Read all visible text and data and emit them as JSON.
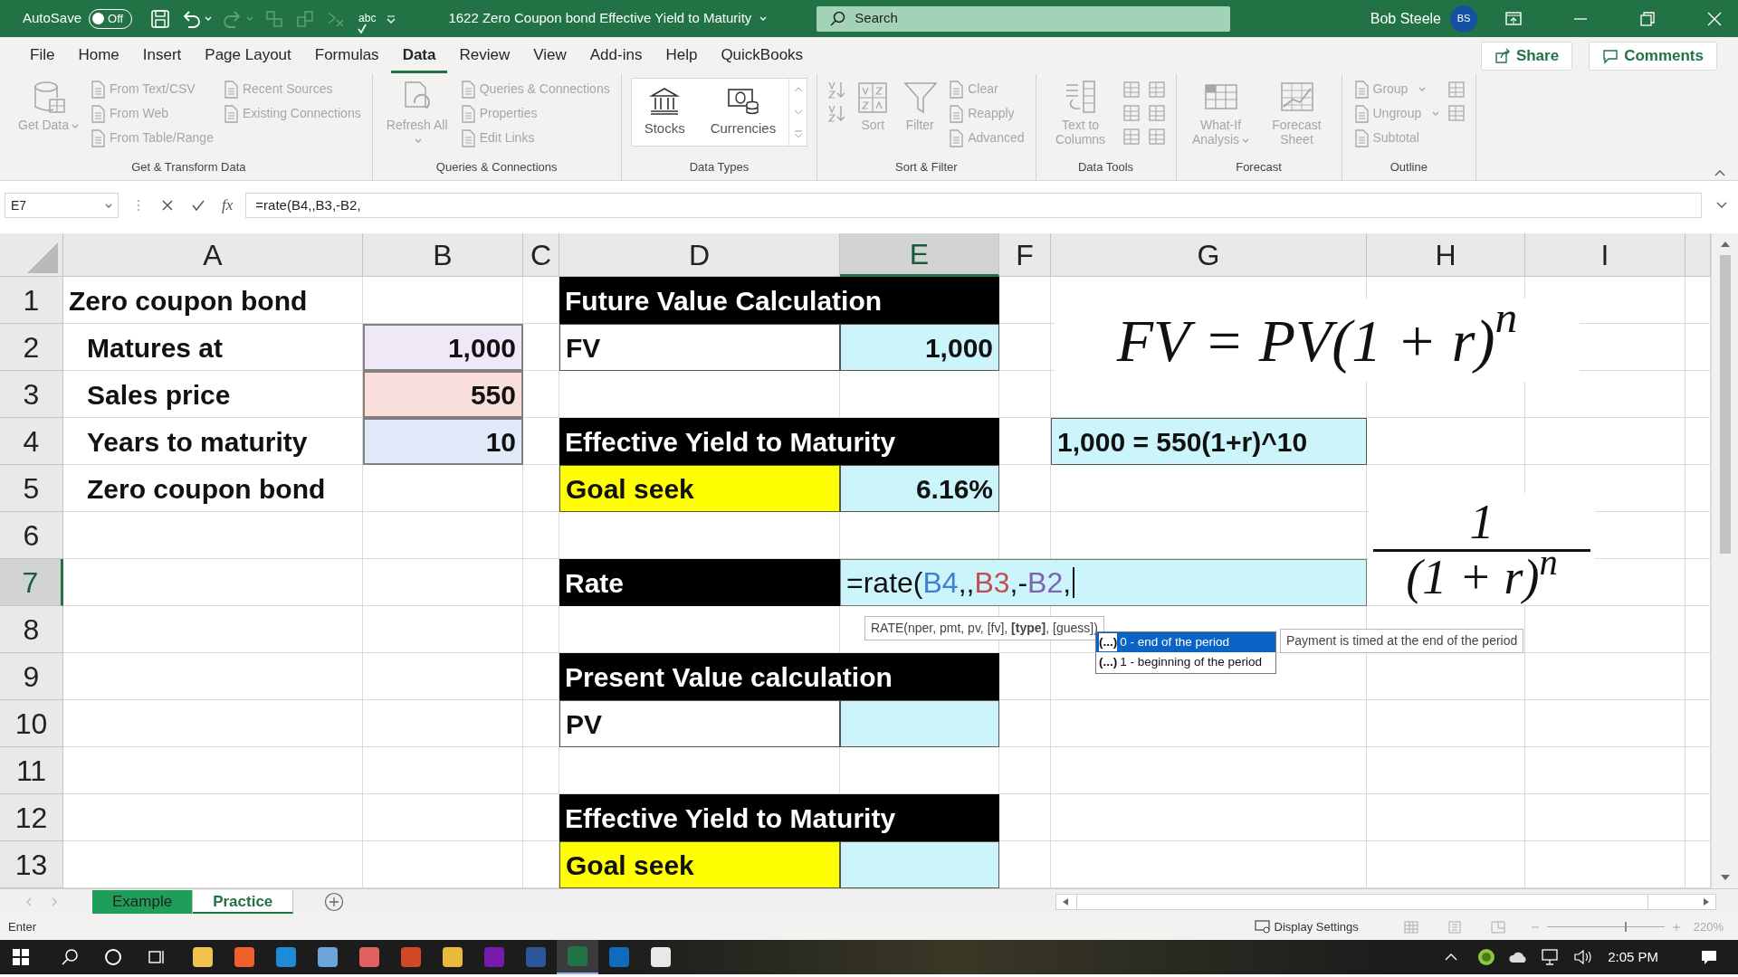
{
  "title_bar": {
    "autosave": {
      "label": "AutoSave",
      "state_text": "Off",
      "on": false
    },
    "spell_label": "abc",
    "document_title": "1622 Zero Coupon bond Effective Yield to Maturity",
    "search": {
      "placeholder": "Search"
    },
    "user": {
      "name": "Bob Steele",
      "initials": "BS"
    }
  },
  "menu_tabs": [
    {
      "label": "File",
      "selected": false
    },
    {
      "label": "Home",
      "selected": false
    },
    {
      "label": "Insert",
      "selected": false
    },
    {
      "label": "Page Layout",
      "selected": false
    },
    {
      "label": "Formulas",
      "selected": false
    },
    {
      "label": "Data",
      "selected": true
    },
    {
      "label": "Review",
      "selected": false
    },
    {
      "label": "View",
      "selected": false
    },
    {
      "label": "Add-ins",
      "selected": false
    },
    {
      "label": "Help",
      "selected": false
    },
    {
      "label": "QuickBooks",
      "selected": false
    }
  ],
  "share_button": "Share",
  "comments_button": "Comments",
  "ribbon": [
    {
      "label": "Get & Transform Data",
      "items": [
        {
          "kind": "large",
          "label": "Get Data",
          "dropdown": true,
          "disabled": true
        },
        {
          "kind": "stack",
          "entries": [
            {
              "label": "From Text/CSV",
              "disabled": true
            },
            {
              "label": "From Web",
              "disabled": true
            },
            {
              "label": "From Table/Range",
              "disabled": true
            }
          ]
        },
        {
          "kind": "stack",
          "entries": [
            {
              "label": "Recent Sources",
              "disabled": true
            },
            {
              "label": "Existing Connections",
              "disabled": true
            }
          ]
        }
      ]
    },
    {
      "label": "Queries & Connections",
      "items": [
        {
          "kind": "large",
          "label": "Refresh All",
          "dropdown": true,
          "disabled": true
        },
        {
          "kind": "stack",
          "entries": [
            {
              "label": "Queries & Connections",
              "disabled": true
            },
            {
              "label": "Properties",
              "disabled": true
            },
            {
              "label": "Edit Links",
              "disabled": true
            }
          ]
        }
      ]
    },
    {
      "label": "Data Types",
      "items": [
        {
          "kind": "gallery",
          "entries": [
            {
              "label": "Stocks",
              "disabled": false
            },
            {
              "label": "Currencies",
              "disabled": false
            }
          ]
        }
      ]
    },
    {
      "label": "Sort & Filter",
      "items": [
        {
          "kind": "icons",
          "entries": [
            {
              "disabled": true
            },
            {
              "disabled": true
            }
          ]
        },
        {
          "kind": "large",
          "label": "Sort",
          "dropdown": false,
          "disabled": true
        },
        {
          "kind": "large",
          "label": "Filter",
          "dropdown": false,
          "disabled": true
        },
        {
          "kind": "stack",
          "entries": [
            {
              "label": "Clear",
              "disabled": true
            },
            {
              "label": "Reapply",
              "disabled": true
            },
            {
              "label": "Advanced",
              "disabled": true
            }
          ]
        }
      ]
    },
    {
      "label": "Data Tools",
      "items": [
        {
          "kind": "large",
          "label": "Text to Columns",
          "dropdown": false,
          "disabled": true
        },
        {
          "kind": "icons",
          "entries": [
            {
              "disabled": true
            },
            {
              "disabled": true
            },
            {
              "disabled": true
            }
          ]
        },
        {
          "kind": "icons",
          "entries": [
            {
              "disabled": true
            },
            {
              "disabled": true
            },
            {
              "disabled": true
            }
          ]
        }
      ]
    },
    {
      "label": "Forecast",
      "items": [
        {
          "kind": "large",
          "label": "What-If Analysis",
          "dropdown": true,
          "disabled": true
        },
        {
          "kind": "large",
          "label": "Forecast Sheet",
          "dropdown": false,
          "disabled": true
        }
      ]
    },
    {
      "label": "Outline",
      "items": [
        {
          "kind": "stack",
          "entries": [
            {
              "label": "Group",
              "dropdown": true,
              "disabled": true
            },
            {
              "label": "Ungroup",
              "dropdown": true,
              "disabled": true
            },
            {
              "label": "Subtotal",
              "disabled": true
            }
          ]
        },
        {
          "kind": "icons",
          "entries": [
            {
              "disabled": true
            },
            {
              "disabled": true
            }
          ]
        }
      ]
    }
  ],
  "formula_bar": {
    "name_box": "E7",
    "fx": "fx",
    "formula": "=rate(B4,,B3,-B2,"
  },
  "columns": [
    {
      "label": "A",
      "selected": false
    },
    {
      "label": "B",
      "selected": false
    },
    {
      "label": "C",
      "selected": false
    },
    {
      "label": "D",
      "selected": false
    },
    {
      "label": "E",
      "selected": true
    },
    {
      "label": "F",
      "selected": false
    },
    {
      "label": "G",
      "selected": false
    },
    {
      "label": "H",
      "selected": false
    },
    {
      "label": "I",
      "selected": false
    }
  ],
  "rows": [
    {
      "label": "1",
      "selected": false,
      "cells": {
        "A": {
          "kind": "text",
          "text": "Zero coupon bond"
        },
        "D": {
          "kind": "section-header",
          "text": "Future Value Calculation"
        }
      }
    },
    {
      "label": "2",
      "selected": false,
      "cells": {
        "A": {
          "kind": "label",
          "text": "Matures at"
        },
        "B": {
          "kind": "value",
          "text": "1,000",
          "color": "#efe8f6",
          "highlighted": true
        },
        "D": {
          "kind": "text",
          "text": "FV",
          "color": "#ffffff"
        },
        "E": {
          "kind": "value",
          "text": "1,000",
          "color": "#ccf4fb"
        }
      }
    },
    {
      "label": "3",
      "selected": false,
      "cells": {
        "A": {
          "kind": "label",
          "text": "Sales price"
        },
        "B": {
          "kind": "value",
          "text": "550",
          "color": "#f9dfdb",
          "highlighted": true
        }
      }
    },
    {
      "label": "4",
      "selected": false,
      "cells": {
        "A": {
          "kind": "label",
          "text": "Years to maturity"
        },
        "B": {
          "kind": "value",
          "text": "10",
          "color": "#e0eaf8",
          "highlighted": true
        },
        "D": {
          "kind": "section-header",
          "text": "Effective Yield to Maturity"
        },
        "G": {
          "kind": "text",
          "text": "1,000 = 550(1+r)^10",
          "color": "#ccf4fb"
        }
      }
    },
    {
      "label": "5",
      "selected": false,
      "cells": {
        "A": {
          "kind": "label",
          "text": "Zero coupon bond"
        },
        "D": {
          "kind": "text",
          "text": "Goal seek",
          "color": "#ffff00"
        },
        "E": {
          "kind": "value",
          "text": "6.16%",
          "color": "#ccf4fb"
        }
      }
    },
    {
      "label": "6",
      "selected": false,
      "cells": {}
    },
    {
      "label": "7",
      "selected": true,
      "cells": {
        "D": {
          "kind": "header",
          "text": "Rate"
        },
        "E": {
          "kind": "edit",
          "color": "#ccf4fb",
          "segments": [
            {
              "text": "=rate("
            },
            {
              "text": "B4",
              "color": "#3f7fd0"
            },
            {
              "text": ",,"
            },
            {
              "text": "B3",
              "color": "#c0504d"
            },
            {
              "text": ",-"
            },
            {
              "text": "B2",
              "color": "#7e63b0"
            },
            {
              "text": ","
            }
          ]
        }
      }
    },
    {
      "label": "8",
      "selected": false,
      "cells": {}
    },
    {
      "label": "9",
      "selected": false,
      "cells": {
        "D": {
          "kind": "section-header",
          "text": "Present Value calculation"
        }
      }
    },
    {
      "label": "10",
      "selected": false,
      "cells": {
        "D": {
          "kind": "text",
          "text": "PV",
          "color": "#ffffff"
        },
        "E": {
          "kind": "value",
          "color": "#ccf4fb"
        }
      }
    },
    {
      "label": "11",
      "selected": false,
      "cells": {}
    },
    {
      "label": "12",
      "selected": false,
      "cells": {
        "D": {
          "kind": "section-header",
          "text": "Effective Yield to Maturity"
        }
      }
    },
    {
      "label": "13",
      "selected": false,
      "cells": {
        "D": {
          "kind": "text",
          "text": "Goal seek",
          "color": "#ffff00"
        },
        "E": {
          "kind": "value",
          "color": "#ccf4fb"
        }
      }
    }
  ],
  "formula_images": [
    {
      "kind": "equation",
      "text": "FV = PV(1 + r)$^{n}$"
    },
    {
      "kind": "fraction",
      "numerator": "1",
      "denominator": "(1 + r)$^{n}$"
    }
  ],
  "function_tooltip": "RATE(nper, pmt, pv, [fv], **[type]**, [guess])",
  "autocomplete": [
    {
      "marker": "(...)",
      "label": "0 - end of the period",
      "selected": true
    },
    {
      "marker": "(...)",
      "label": "1 - beginning of the period",
      "selected": false
    }
  ],
  "autocomplete_tip": "Payment is timed at the end of the period",
  "sheet_tabs": [
    {
      "label": "Example",
      "selected": false,
      "color": "#1e9e58"
    },
    {
      "label": "Practice",
      "selected": true
    }
  ],
  "status_bar": {
    "mode": "Enter",
    "display_settings": "Display Settings",
    "zoom": "220%",
    "zoom_slider": {
      "level": 0.66
    }
  },
  "taskbar": {
    "apps": [
      {
        "color": "#f2c14e",
        "selected": false
      },
      {
        "color": "#f0602c",
        "selected": false
      },
      {
        "color": "#1d8bd6",
        "selected": false
      },
      {
        "color": "#6ba4d8",
        "selected": false
      },
      {
        "color": "#e06060",
        "selected": false
      },
      {
        "color": "#d24726",
        "selected": false
      },
      {
        "color": "#e8b93a",
        "selected": false
      },
      {
        "color": "#7719aa",
        "selected": false
      },
      {
        "color": "#2b579a",
        "selected": false
      },
      {
        "color": "#217346",
        "selected": true
      },
      {
        "color": "#0f6cbd",
        "selected": false
      },
      {
        "color": "#e8e8e8",
        "selected": false
      }
    ],
    "time": "2:05 PM"
  }
}
